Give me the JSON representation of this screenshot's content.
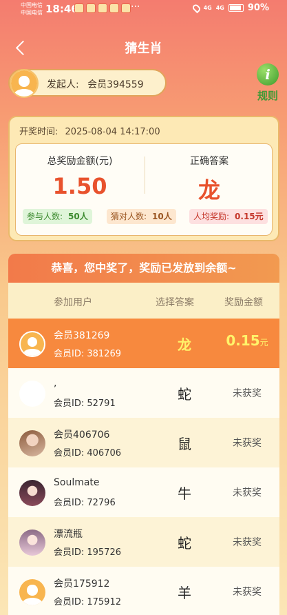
{
  "status_bar": {
    "carrier1": "中国电信",
    "carrier2": "中国电信",
    "time": "18:46",
    "more": "···",
    "signal": "4G",
    "battery": "90%"
  },
  "header": {
    "title": "猜生肖"
  },
  "initiator": {
    "label": "发起人:",
    "name": "会员394559"
  },
  "rules": {
    "icon_glyph": "i",
    "label": "规则"
  },
  "draw": {
    "time_label": "开奖时间:",
    "time_value": "2025-08-04 14:17:00",
    "total_label": "总奖励金额(元)",
    "total_value": "1.50",
    "answer_label": "正确答案",
    "answer_value": "龙",
    "participants_label": "参与人数:",
    "participants_value": "50人",
    "correct_label": "猜对人数:",
    "correct_value": "10人",
    "per_label": "人均奖励:",
    "per_value": "0.15元"
  },
  "results": {
    "banner": "恭喜，您中奖了，奖励已发放到余额~",
    "headers": {
      "user": "参加用户",
      "answer": "选择答案",
      "reward": "奖励金额"
    },
    "rows": [
      {
        "name": "会员381269",
        "id": "会员ID:  381269",
        "answer": "龙",
        "reward": "0.15",
        "reward_unit": "元",
        "avatar": "default"
      },
      {
        "name": ",",
        "id": "会员ID:  52791",
        "answer": "蛇",
        "reward": "未获奖",
        "avatar": "blank"
      },
      {
        "name": "会员406706",
        "id": "会员ID:  406706",
        "answer": "鼠",
        "reward": "未获奖",
        "avatar": "photo"
      },
      {
        "name": "Soulmate",
        "id": "会员ID:  72796",
        "answer": "牛",
        "reward": "未获奖",
        "avatar": "photo"
      },
      {
        "name": "漂流瓶",
        "id": "会员ID:  195726",
        "answer": "蛇",
        "reward": "未获奖",
        "avatar": "photo"
      },
      {
        "name": "会员175912",
        "id": "会员ID:  175912",
        "answer": "羊",
        "reward": "未获奖",
        "avatar": "default"
      }
    ]
  },
  "colors": {
    "accent": "#f7893e",
    "value_red": "#e8522d",
    "highlight_text": "#fff36a",
    "rules_green": "#3f9a35"
  }
}
